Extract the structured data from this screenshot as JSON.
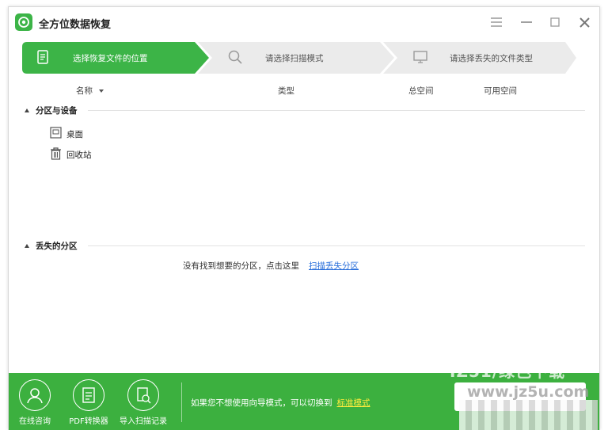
{
  "app": {
    "title": "全方位数据恢复"
  },
  "steps": [
    {
      "label": "选择恢复文件的位置",
      "active": true
    },
    {
      "label": "请选择扫描模式",
      "active": false
    },
    {
      "label": "请选择丢失的文件类型",
      "active": false
    }
  ],
  "columns": {
    "name": "名称",
    "type": "类型",
    "total": "总空间",
    "free": "可用空间"
  },
  "sections": {
    "partitions": {
      "label": "分区与设备",
      "items": [
        {
          "label": "桌面",
          "icon": "desktop-icon"
        },
        {
          "label": "回收站",
          "icon": "recycle-bin-icon"
        }
      ]
    },
    "lost": {
      "label": "丢失的分区",
      "hint": "没有找到想要的分区，点击这里",
      "link": "扫描丢失分区"
    }
  },
  "bottom": {
    "tools": [
      {
        "label": "在线咨询",
        "icon": "user-support-icon"
      },
      {
        "label": "PDF转换器",
        "icon": "pdf-icon"
      },
      {
        "label": "导入扫描记录",
        "icon": "import-record-icon"
      }
    ],
    "hint": "如果您不想使用向导模式，可以切换到",
    "link": "标准模式"
  },
  "watermark": {
    "line1": "IZ51/绿色下载",
    "line2": "www.jz5u.com"
  },
  "colors": {
    "accent": "#3cb447",
    "link": "#2a6fdb",
    "bottom_link": "#ffec3d"
  }
}
